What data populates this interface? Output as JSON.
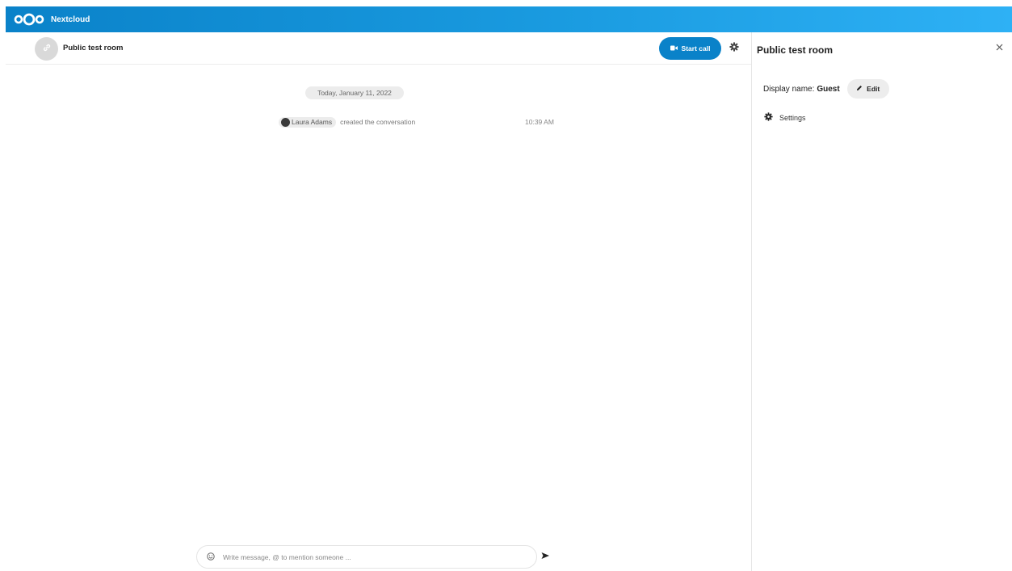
{
  "app": {
    "name": "Nextcloud"
  },
  "header": {
    "room_title": "Public test room",
    "start_call_label": "Start call"
  },
  "chat": {
    "date_separator": "Today, January 11, 2022",
    "system_message": {
      "actor": "Laura Adams",
      "text": "created the conversation",
      "time": "10:39 AM"
    },
    "composer_placeholder": "Write message, @ to mention someone ..."
  },
  "sidebar": {
    "title": "Public test room",
    "display_name_label": "Display name:",
    "display_name_value": "Guest",
    "edit_label": "Edit",
    "settings_label": "Settings"
  },
  "colors": {
    "brand": "#0a82c9",
    "header_gradient_end": "#2eb1f5"
  },
  "icons": [
    "nextcloud-logo",
    "link-icon",
    "video-camera-icon",
    "gear-icon",
    "emoji-icon",
    "send-icon",
    "close-icon",
    "pencil-icon"
  ]
}
